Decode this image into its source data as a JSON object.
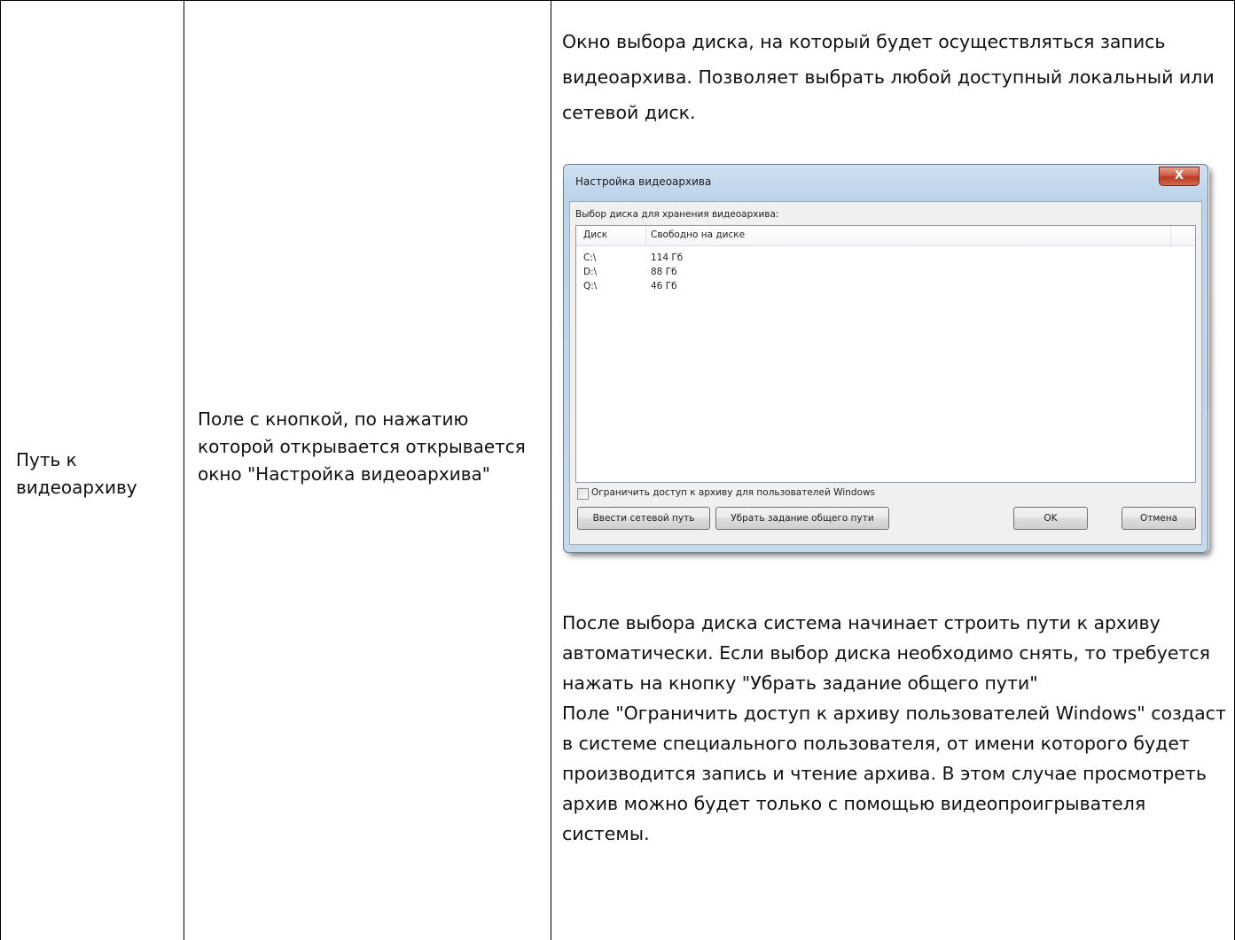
{
  "row": {
    "name": "Путь к видеоархиву",
    "description": "Поле с кнопкой, по нажатию которой открывается открывается окно \"Настройка видеоархива\"",
    "details_intro": "Окно выбора диска, на который будет осуществляться запись видеоархива. Позволяет выбрать любой доступный локальный или сетевой диск.",
    "details_after_1": "После выбора диска система начинает строить пути к архиву автоматически. Если выбор диска необходимо снять, то требуется нажать на кнопку \"Убрать задание общего пути\"",
    "details_after_2": "Поле \"Ограничить доступ к архиву пользователей Windows\" создаст в системе специального пользователя, от имени которого будет производится запись и чтение архива. В этом случае просмотреть архив можно будет только с помощью видеопроигрывателя системы."
  },
  "dialog": {
    "title": "Настройка видеоархива",
    "close_label": "X",
    "group_label": "Выбор диска для хранения видеоархива:",
    "columns": [
      "Диск",
      "Свободно на диске"
    ],
    "rows": [
      {
        "disk": "C:\\",
        "free": "114 Гб"
      },
      {
        "disk": "D:\\",
        "free": "88 Гб"
      },
      {
        "disk": "Q:\\",
        "free": "46 Гб"
      }
    ],
    "restrict_label": "Ограничить доступ к архиву для пользователей Windows",
    "restrict_checked": false,
    "buttons": {
      "network_path": "Ввести сетевой путь",
      "clear_path": "Убрать задание общего пути",
      "ok": "OK",
      "cancel": "Отмена"
    }
  },
  "colors": {
    "border": "#000000",
    "text": "#111111",
    "dialog_frame": "#bcd3ea",
    "close_button": "#c9462e"
  }
}
